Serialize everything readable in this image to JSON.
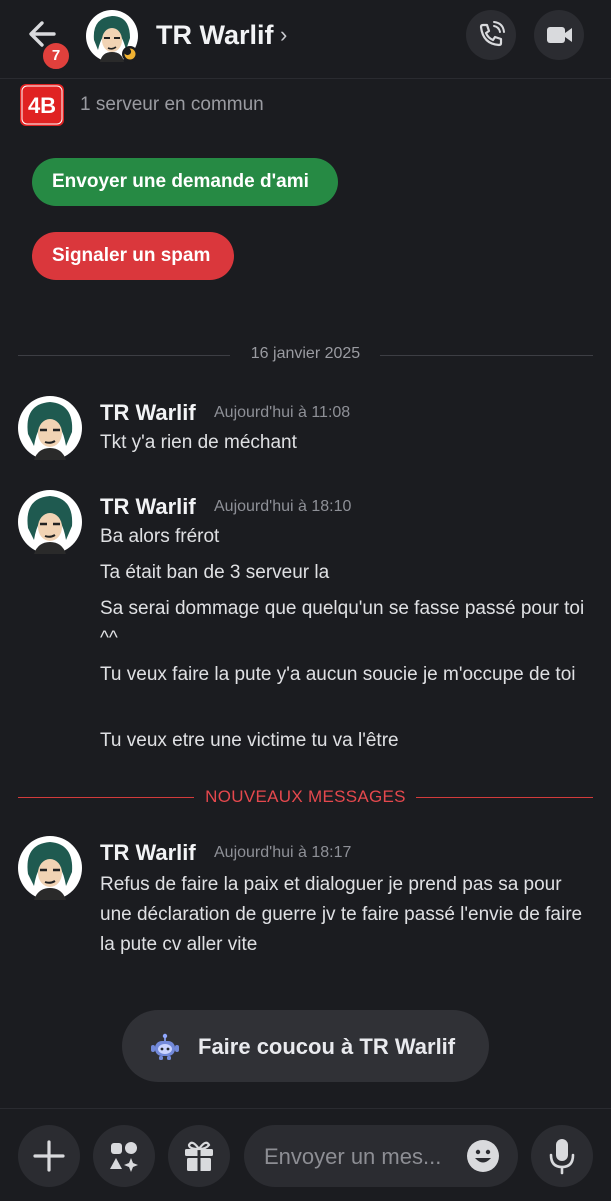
{
  "header": {
    "back_badge": "7",
    "title": "TR Warlif",
    "chevron": "›"
  },
  "common": {
    "server_icon_text": "4B",
    "text": "1 serveur en commun"
  },
  "actions": {
    "friend_request": "Envoyer une demande d'ami",
    "report_spam": "Signaler un spam"
  },
  "date_divider": "16 janvier 2025",
  "new_messages_divider": "NOUVEAUX MESSAGES",
  "messages": [
    {
      "author": "TR Warlif",
      "time": "Aujourd'hui à 11:08",
      "lines": [
        "Tkt y'a rien de méchant"
      ]
    },
    {
      "author": "TR Warlif",
      "time": "Aujourd'hui à 18:10",
      "lines": [
        "Ba alors frérot",
        "Ta était ban de 3 serveur la",
        "Sa serai dommage que quelqu'un se fasse passé pour toi ^^",
        "Tu veux faire la pute y'a aucun soucie je m'occupe de toi",
        "Tu veux etre une victime tu va l'être"
      ]
    },
    {
      "author": "TR Warlif",
      "time": "Aujourd'hui à 18:17",
      "lines": [
        "Refus de faire la paix et dialoguer je prend pas sa pour une déclaration de guerre jv te faire passé l'envie de faire la pute cv aller vite"
      ]
    }
  ],
  "wave_button": "Faire coucou à TR Warlif",
  "composer": {
    "placeholder": "Envoyer un mes..."
  },
  "icons": {
    "back": "arrow-left-icon",
    "call": "phone-icon",
    "video": "video-camera-icon",
    "add": "plus-icon",
    "apps": "apps-icon",
    "gift": "gift-icon",
    "emoji": "emoji-icon",
    "mic": "microphone-icon",
    "wave": "wumpus-icon"
  },
  "colors": {
    "background": "#1b1c20",
    "friend_button": "#268a44",
    "spam_button": "#da373c",
    "new_divider": "#e5484d",
    "badge": "#e0403c"
  }
}
